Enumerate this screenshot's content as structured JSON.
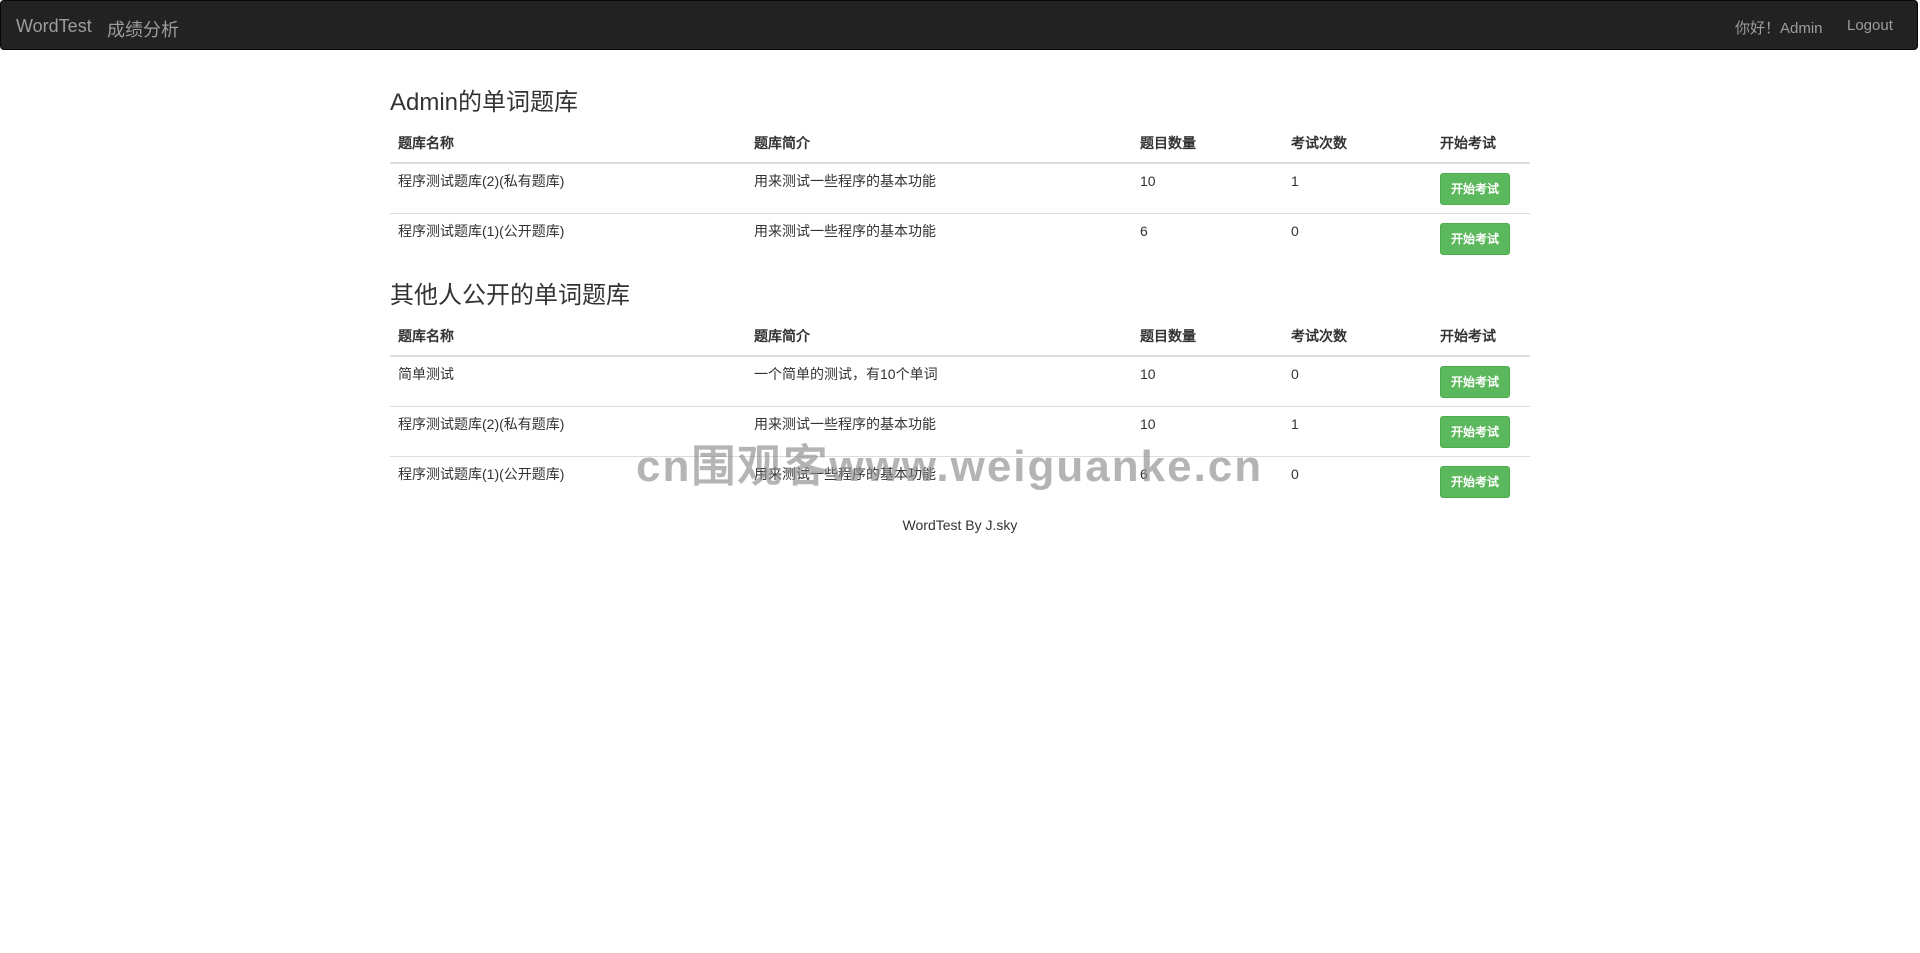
{
  "navbar": {
    "brand": "WordTest",
    "analysis_link": "成绩分析",
    "greeting": "你好！Admin",
    "logout": "Logout"
  },
  "own_section": {
    "title": "Admin的单词题库",
    "headers": [
      "题库名称",
      "题库简介",
      "题目数量",
      "考试次数",
      "开始考试"
    ],
    "rows": [
      {
        "name": "程序测试题库(2)(私有题库)",
        "desc": "用来测试一些程序的基本功能",
        "count": "10",
        "times": "1",
        "action": "开始考试"
      },
      {
        "name": "程序测试题库(1)(公开题库)",
        "desc": "用来测试一些程序的基本功能",
        "count": "6",
        "times": "0",
        "action": "开始考试"
      }
    ]
  },
  "public_section": {
    "title": "其他人公开的单词题库",
    "headers": [
      "题库名称",
      "题库简介",
      "题目数量",
      "考试次数",
      "开始考试"
    ],
    "rows": [
      {
        "name": "简单测试",
        "desc": "一个简单的测试，有10个单词",
        "count": "10",
        "times": "0",
        "action": "开始考试"
      },
      {
        "name": "程序测试题库(2)(私有题库)",
        "desc": "用来测试一些程序的基本功能",
        "count": "10",
        "times": "1",
        "action": "开始考试"
      },
      {
        "name": "程序测试题库(1)(公开题库)",
        "desc": "用来测试一些程序的基本功能",
        "count": "6",
        "times": "0",
        "action": "开始考试"
      }
    ]
  },
  "footer": "WordTest By J.sky",
  "watermark": "cn围观客www.weiguanke.cn",
  "colors": {
    "navbar_bg": "#222222",
    "nav_text": "#9d9d9d",
    "button_success": "#5cb85c"
  }
}
